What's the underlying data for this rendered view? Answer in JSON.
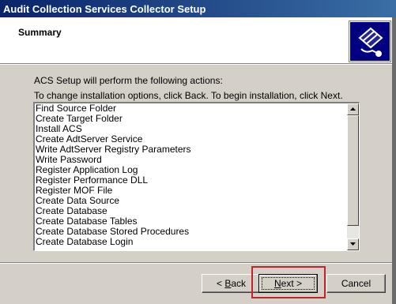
{
  "window": {
    "title": "Audit Collection Services Collector Setup"
  },
  "header": {
    "title": "Summary",
    "icon": "setup-wizard-icon"
  },
  "intro_text": "ACS Setup will perform the following actions:",
  "instruction_text": "To change installation options, click Back. To begin installation, click Next.",
  "actions_list": {
    "items": [
      "Find Source Folder",
      "Create Target Folder",
      "Install ACS",
      "Create AdtServer Service",
      "Write AdtServer Registry Parameters",
      "Write Password",
      "Register Application Log",
      "Register Performance DLL",
      "Register MOF File",
      "Create Data Source",
      "Create Database",
      "Create Database Tables",
      "Create Database Stored Procedures",
      "Create Database Login"
    ]
  },
  "buttons": {
    "back_prefix": "< ",
    "back_accel": "B",
    "back_rest": "ack",
    "next_accel": "N",
    "next_rest": "ext >",
    "cancel": "Cancel"
  },
  "colors": {
    "titlebar_start": "#0a246a",
    "titlebar_end": "#3a6ea5",
    "highlight_box": "#c0252c",
    "icon_bg": "#000080"
  }
}
